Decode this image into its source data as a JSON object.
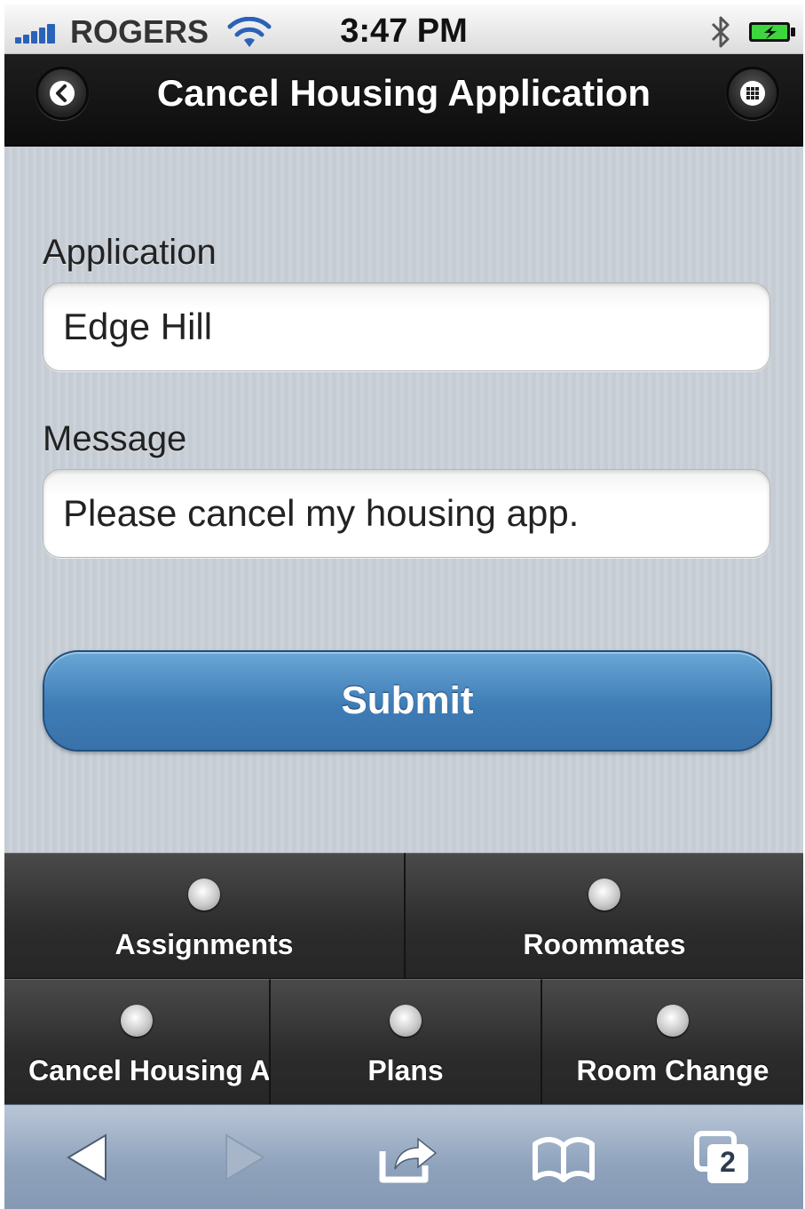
{
  "status_bar": {
    "carrier": "ROGERS",
    "time": "3:47 PM",
    "icons": [
      "signal-icon",
      "wifi-icon",
      "bluetooth-icon",
      "battery-charging-icon"
    ]
  },
  "header": {
    "title": "Cancel Housing Application",
    "back_icon": "chevron-left-icon",
    "menu_icon": "grid-icon"
  },
  "form": {
    "application_label": "Application",
    "application_value": "Edge Hill",
    "message_label": "Message",
    "message_value": "Please cancel my housing app.",
    "submit_label": "Submit"
  },
  "tab_bar": {
    "row1": [
      {
        "label": "Assignments",
        "icon": "dot-icon"
      },
      {
        "label": "Roommates",
        "icon": "dot-icon"
      }
    ],
    "row2": [
      {
        "label": "Cancel Housing Application",
        "icon": "dot-icon"
      },
      {
        "label": "Plans",
        "icon": "dot-icon"
      },
      {
        "label": "Room Change",
        "icon": "dot-icon"
      }
    ]
  },
  "browser_toolbar": {
    "tabs_count": "2",
    "icons": [
      "back-arrow-icon",
      "forward-arrow-icon",
      "share-icon",
      "bookmarks-icon",
      "tabs-icon"
    ]
  },
  "colors": {
    "submit_blue": "#3e7cb6",
    "header_black": "#111111",
    "content_bg": "#c5ccd4"
  }
}
